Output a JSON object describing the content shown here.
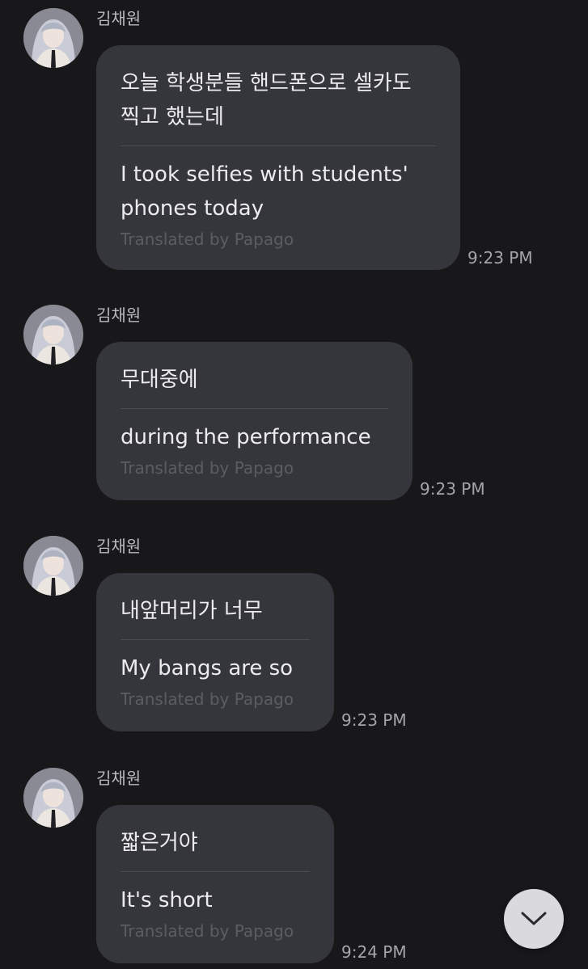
{
  "theme": {
    "background": "#18181b",
    "bubble": "#35353c",
    "text": "#ececee",
    "credit": "#5c5c64",
    "scroll_button": "#d9d9de"
  },
  "messages": [
    {
      "sender": "김채원",
      "original": "오늘 학생분들 핸드폰으로 셀카도\n찍고 했는데",
      "translation": "I took selfies with students'\nphones today",
      "credit": "Translated by Papago",
      "time": "9:23 PM"
    },
    {
      "sender": "김채원",
      "original": "무대중에",
      "translation": "during the performance",
      "credit": "Translated by Papago",
      "time": "9:23 PM"
    },
    {
      "sender": "김채원",
      "original": "내앞머리가 너무",
      "translation": "My bangs are so",
      "credit": "Translated by Papago",
      "time": "9:23 PM"
    },
    {
      "sender": "김채원",
      "original": "짧은거야",
      "translation": "It's short",
      "credit": "Translated by Papago",
      "time": "9:24 PM"
    }
  ],
  "scroll_button_icon": "chevron-down-icon"
}
